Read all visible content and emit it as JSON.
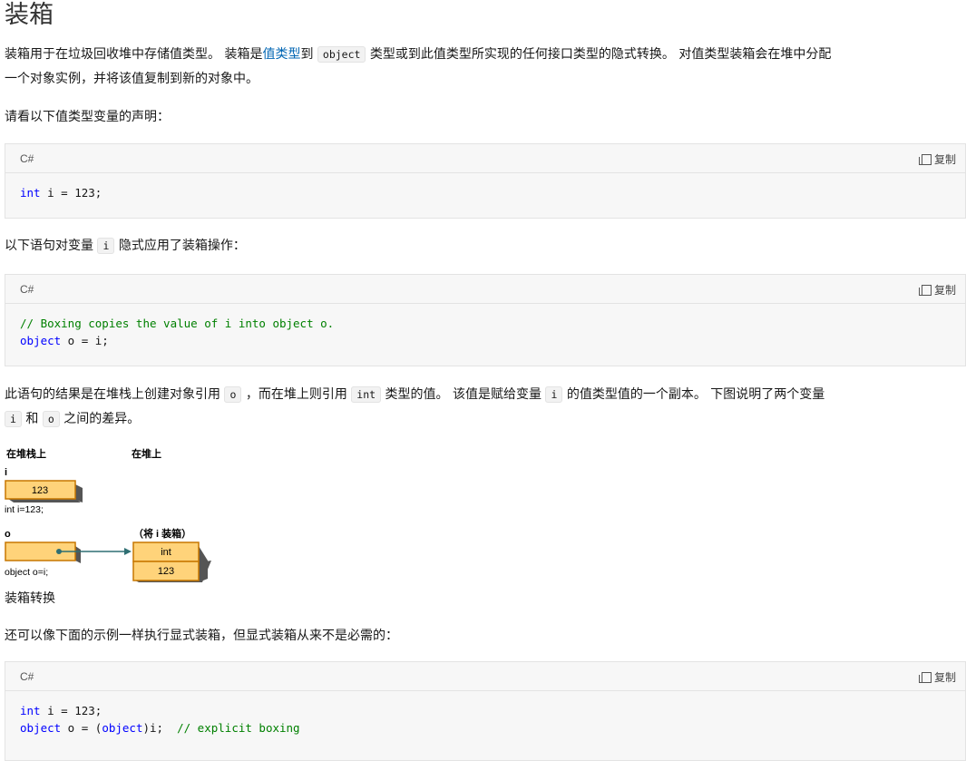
{
  "heading": "装箱",
  "para1": {
    "t1": "装箱用于在垃圾回收堆中存储值类型。 装箱是",
    "link": "值类型",
    "t2": "到",
    "code1": "object",
    "t3": "类型或到此值类型所实现的任何接口类型的隐式转换。 对值类型装箱会在堆中分配",
    "line2": "一个对象实例，并将该值复制到新的对象中。"
  },
  "para2": "请看以下值类型变量的声明：",
  "code1": {
    "lang": "C#",
    "copy_label": "复制",
    "line1_kw": "int",
    "line1_rest": " i = 123;"
  },
  "para3": {
    "t1": "以下语句对变量",
    "code": "i",
    "t2": "隐式应用了装箱操作："
  },
  "code2": {
    "lang": "C#",
    "copy_label": "复制",
    "comment": "// Boxing copies the value of i into object o.",
    "line2_kw": "object",
    "line2_rest": " o = i;"
  },
  "para4": {
    "t1": "此语句的结果是在堆栈上创建对象引用",
    "code_o": "o",
    "t2": "，而在堆上则引用",
    "code_int": "int",
    "t3": "类型的值。 该值是赋给变量",
    "code_i": "i",
    "t4": "的值类型值的一个副本。 下图说明了两个变量",
    "code_i2": "i",
    "t5": "和",
    "code_o2": "o",
    "t6": "之间的差异。"
  },
  "diagram": {
    "stack_label": "在堆栈上",
    "heap_label": "在堆上",
    "var_i": "i",
    "i_value": "123",
    "i_caption": "int i=123;",
    "var_o": "o",
    "boxing_label": "（将 i 装箱）",
    "box_type": "int",
    "box_value": "123",
    "o_caption": "object o=i;",
    "colors": {
      "fill": "#ffd37a",
      "stroke": "#c77700",
      "shadow": "#555555",
      "arrow": "#2f6f73"
    }
  },
  "caption": "装箱转换",
  "para5": "还可以像下面的示例一样执行显式装箱，但显式装箱从来不是必需的：",
  "code3": {
    "lang": "C#",
    "copy_label": "复制",
    "line1_kw": "int",
    "line1_rest": " i = 123;",
    "line2_kw": "object",
    "line2_mid": " o = (",
    "line2_kw2": "object",
    "line2_rest": ")i;  ",
    "line2_comment": "// explicit boxing"
  }
}
